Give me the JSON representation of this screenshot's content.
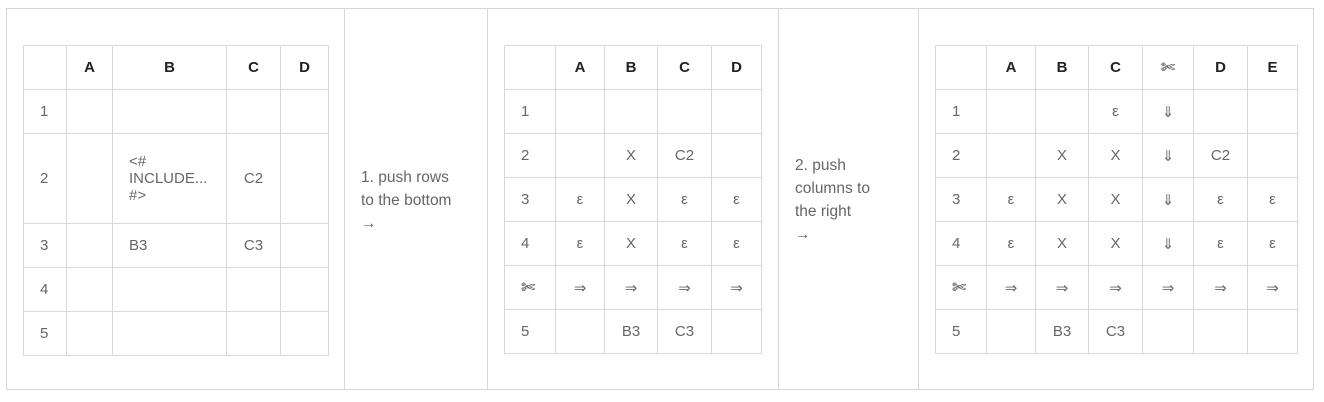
{
  "panel1": {
    "headers": [
      "",
      "A",
      "B",
      "C",
      "D"
    ],
    "rows": [
      [
        "1",
        "",
        "",
        "",
        ""
      ],
      [
        "2",
        "",
        "<#\nINCLUDE...\n#>",
        "C2",
        ""
      ],
      [
        "3",
        "",
        "B3",
        "C3",
        ""
      ],
      [
        "4",
        "",
        "",
        "",
        ""
      ],
      [
        "5",
        "",
        "",
        "",
        ""
      ]
    ]
  },
  "step1": {
    "text": "1. push rows\nto the bottom\n→"
  },
  "panel2": {
    "headers": [
      "",
      "A",
      "B",
      "C",
      "D"
    ],
    "rows": [
      [
        "1",
        "",
        "",
        "",
        ""
      ],
      [
        "2",
        "",
        "X",
        "C2",
        ""
      ],
      [
        "3",
        "ε",
        "X",
        "ε",
        "ε"
      ],
      [
        "4",
        "ε",
        "X",
        "ε",
        "ε"
      ],
      [
        "✄",
        "⇒",
        "⇒",
        "⇒",
        "⇒"
      ],
      [
        "5",
        "",
        "B3",
        "C3",
        ""
      ]
    ]
  },
  "step2": {
    "text": "2. push\ncolumns to\nthe right\n→"
  },
  "panel3": {
    "headers": [
      "",
      "A",
      "B",
      "C",
      "✄",
      "D",
      "E"
    ],
    "rows": [
      [
        "1",
        "",
        "",
        "ε",
        "⇓",
        "",
        ""
      ],
      [
        "2",
        "",
        "X",
        "X",
        "⇓",
        "C2",
        ""
      ],
      [
        "3",
        "ε",
        "X",
        "X",
        "⇓",
        "ε",
        "ε"
      ],
      [
        "4",
        "ε",
        "X",
        "X",
        "⇓",
        "ε",
        "ε"
      ],
      [
        "✄",
        "⇒",
        "⇒",
        "⇒",
        "⇒",
        "⇒",
        "⇒"
      ],
      [
        "5",
        "",
        "B3",
        "C3",
        "",
        "",
        ""
      ]
    ]
  }
}
